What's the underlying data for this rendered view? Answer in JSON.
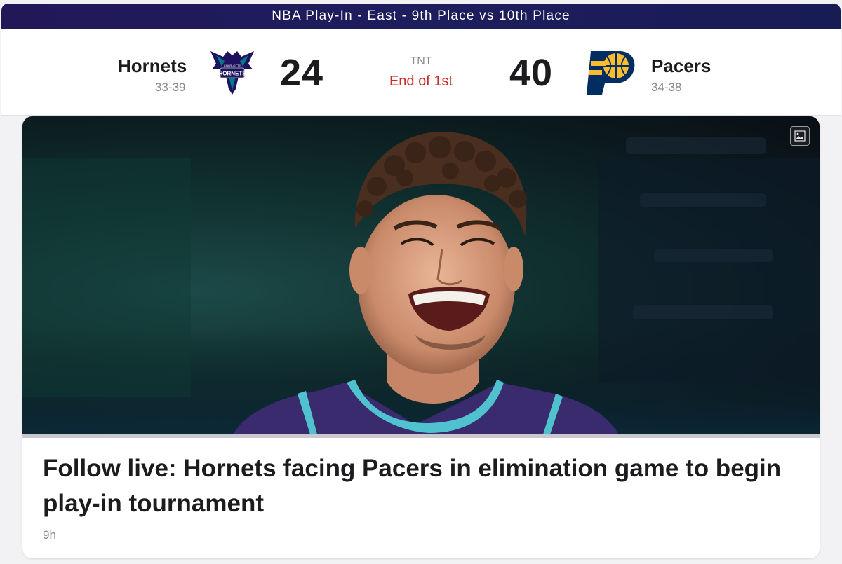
{
  "banner": {
    "text": "NBA Play-In - East - 9th Place vs 10th Place"
  },
  "game": {
    "away": {
      "name": "Hornets",
      "record": "33-39",
      "score": "24",
      "logo_icon": "hornets-logo",
      "logo_wordmark": "HORNETS",
      "logo_top_text": "CHARLOTTE",
      "color_primary": "#1d1160",
      "color_secondary": "#00788c"
    },
    "home": {
      "name": "Pacers",
      "record": "34-38",
      "score": "40",
      "logo_icon": "pacers-logo",
      "color_primary": "#002d62",
      "color_secondary": "#fdbb30"
    },
    "network": "TNT",
    "status": "End of 1st",
    "status_color": "#cc2a24"
  },
  "article": {
    "image_icon": "image-icon",
    "headline": "Follow live: Hornets facing Pacers in elimination game to begin play-in tournament",
    "timestamp": "9h"
  }
}
